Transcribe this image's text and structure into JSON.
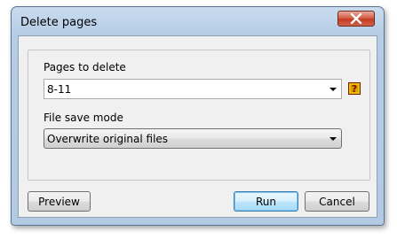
{
  "window": {
    "title": "Delete pages"
  },
  "pages_to_delete": {
    "label": "Pages to delete",
    "value": "8-11",
    "help_glyph": "?"
  },
  "file_save_mode": {
    "label": "File save mode",
    "value": "Overwrite original files"
  },
  "buttons": {
    "preview": "Preview",
    "run": "Run",
    "cancel": "Cancel"
  },
  "icons": {
    "close": "close-icon",
    "help": "help-icon",
    "dropdown": "chevron-down-icon"
  },
  "colors": {
    "title_bar": "#c9dcef",
    "close_button": "#c43a22",
    "client_background": "#f0f0f0",
    "help_icon": "#d0a000",
    "default_button_border": "#3c7fb1"
  }
}
